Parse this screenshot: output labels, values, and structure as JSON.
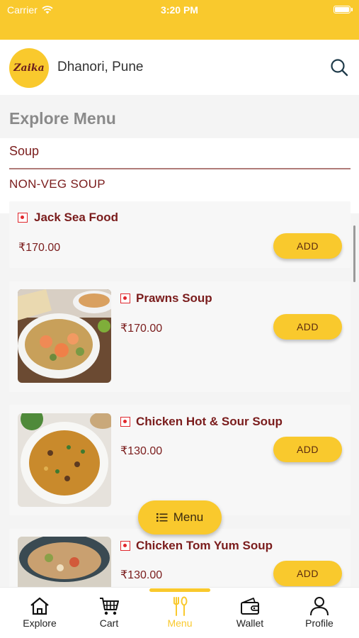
{
  "status_bar": {
    "carrier": "Carrier",
    "time": "3:20 PM"
  },
  "header": {
    "logo_text": "Zaika",
    "location": "Dhanori, Pune"
  },
  "page": {
    "title": "Explore Menu",
    "category": "Soup",
    "section": "NON-VEG SOUP"
  },
  "items": [
    {
      "name": "Jack Sea Food",
      "price": "₹170.00",
      "add_label": "ADD"
    },
    {
      "name": "Prawns Soup",
      "price": "₹170.00",
      "add_label": "ADD"
    },
    {
      "name": "Chicken Hot & Sour Soup",
      "price": "₹130.00",
      "add_label": "ADD"
    },
    {
      "name": "Chicken Tom Yum Soup",
      "price": "₹130.00",
      "add_label": "ADD"
    }
  ],
  "menu_button": {
    "label": "Menu"
  },
  "tabs": [
    {
      "label": "Explore",
      "icon": "home-icon"
    },
    {
      "label": "Cart",
      "icon": "cart-icon"
    },
    {
      "label": "Menu",
      "icon": "fork-spoon-icon",
      "active": true
    },
    {
      "label": "Wallet",
      "icon": "wallet-icon"
    },
    {
      "label": "Profile",
      "icon": "user-icon"
    }
  ],
  "colors": {
    "accent": "#f9c92d",
    "maroon": "#7a1c1c",
    "veg_mark": "#e0272d"
  }
}
